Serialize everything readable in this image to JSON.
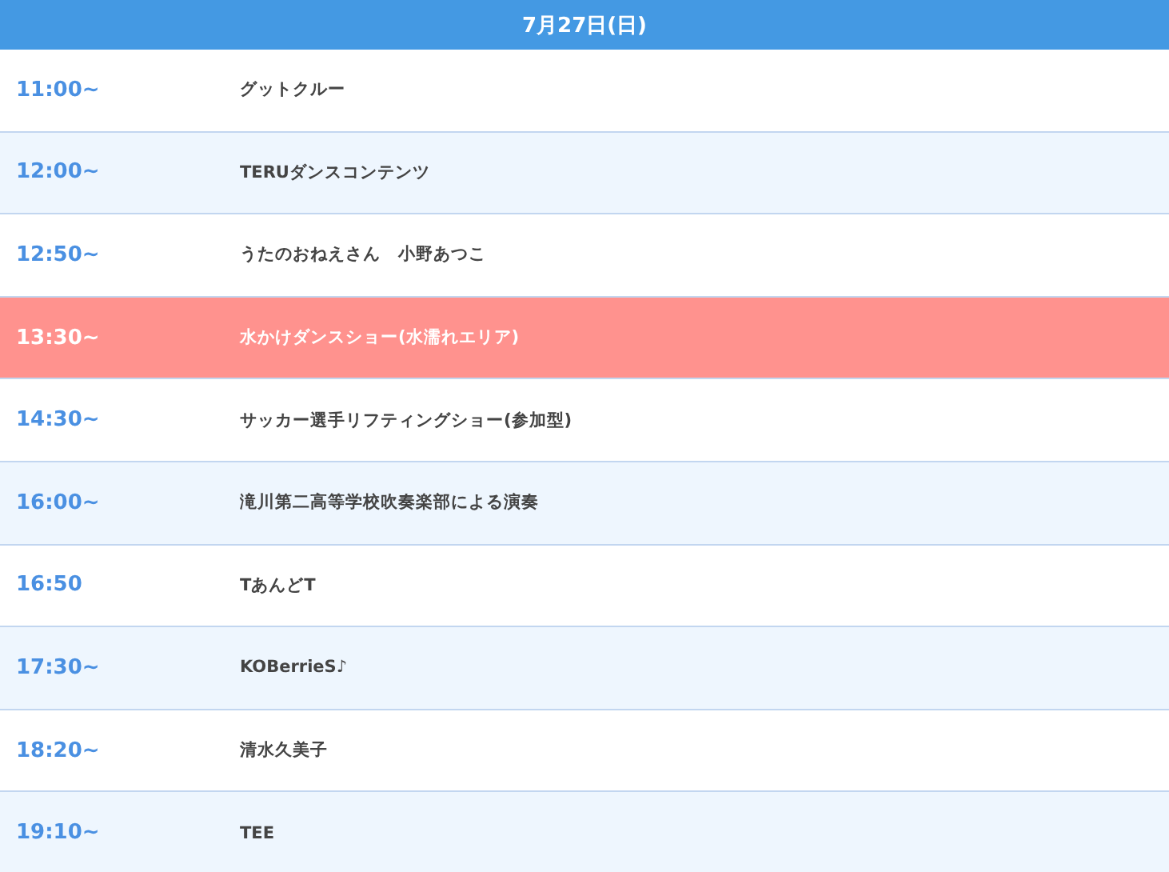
{
  "header": {
    "title": "7月27日(日)"
  },
  "rows": [
    {
      "time": "11:00~",
      "performer": "グットクルー",
      "highlighted": false
    },
    {
      "time": "12:00~",
      "performer": "TERUダンスコンテンツ",
      "highlighted": false
    },
    {
      "time": "12:50~",
      "performer": "うたのおねえさん　小野あつこ",
      "highlighted": false
    },
    {
      "time": "13:30~",
      "performer": "水かけダンスショー(水濡れエリア)",
      "highlighted": true
    },
    {
      "time": "14:30~",
      "performer": "サッカー選手リフティングショー(参加型)",
      "highlighted": false
    },
    {
      "time": "16:00~",
      "performer": "滝川第二高等学校吹奏楽部による演奏",
      "highlighted": false
    },
    {
      "time": "16:50",
      "performer": "TあんどT",
      "highlighted": false
    },
    {
      "time": "17:30~",
      "performer": "KOBerrieS♪",
      "highlighted": false
    },
    {
      "time": "18:20~",
      "performer": "清水久美子",
      "highlighted": false
    },
    {
      "time": "19:10~",
      "performer": "TEE",
      "highlighted": false
    }
  ]
}
